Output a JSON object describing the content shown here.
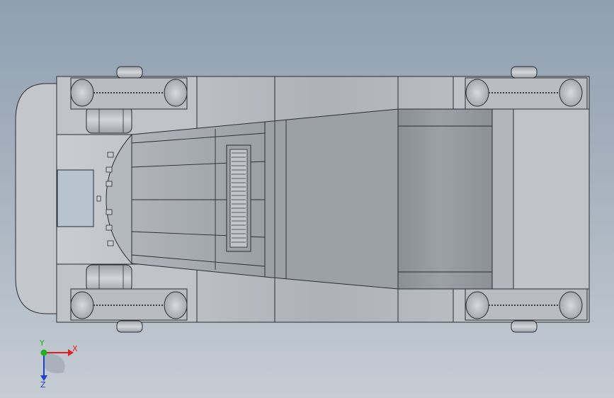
{
  "app": {
    "view": "top"
  },
  "triad": {
    "x_label": "X",
    "y_label": "Y",
    "z_label": "Z",
    "colors": {
      "x": "#e02020",
      "y": "#20b020",
      "z": "#2040d0"
    }
  },
  "colors": {
    "body_light": "#c2c6cb",
    "body_mid": "#a8acb2",
    "body_dark": "#80858c",
    "edge": "#2a2d33"
  }
}
